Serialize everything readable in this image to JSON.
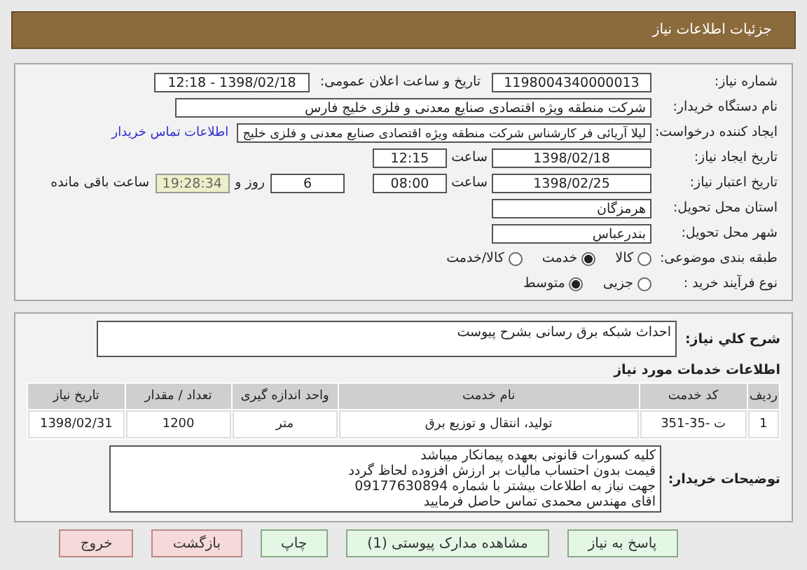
{
  "header": {
    "title": "جزئیات اطلاعات نیاز"
  },
  "need_number": {
    "label": "شماره نیاز:",
    "value": "1198004340000013"
  },
  "announce": {
    "label": "تاریخ و ساعت اعلان عمومی:",
    "value": "1398/02/18 - 12:18"
  },
  "buyer": {
    "label": "نام دستگاه خریدار:",
    "value": "شرکت منطقه ویژه اقتصادی صنایع معدنی و فلزی خلیج فارس"
  },
  "requester": {
    "label": "ایجاد کننده درخواست:",
    "value": "لیلا آریائی فر کارشناس شرکت منطقه ویژه اقتصادی صنایع معدنی و فلزی خلیج",
    "link": "اطلاعات تماس خریدار"
  },
  "created": {
    "label": "تاریخ ایجاد نیاز:",
    "date": "1398/02/18",
    "time_label": "ساعت",
    "time": "12:15"
  },
  "validity": {
    "label": "تاریخ اعتبار نیاز:",
    "date": "1398/02/25",
    "time_label": "ساعت",
    "time": "08:00",
    "days": "6",
    "days_label": "روز و",
    "remaining": "19:28:34",
    "remaining_label": "ساعت باقی مانده"
  },
  "province": {
    "label": "استان محل تحویل:",
    "value": "هرمزگان"
  },
  "city": {
    "label": "شهر محل تحویل:",
    "value": "بندرعباس"
  },
  "category": {
    "label": "طبقه بندی موضوعی:",
    "options": [
      {
        "label": "کالا",
        "selected": false
      },
      {
        "label": "خدمت",
        "selected": true
      },
      {
        "label": "کالا/خدمت",
        "selected": false
      }
    ]
  },
  "process": {
    "label": "نوع فرآیند خرید :",
    "options": [
      {
        "label": "جزیی",
        "selected": false
      },
      {
        "label": "متوسط",
        "selected": true
      }
    ]
  },
  "summary": {
    "label": "شرح کلي نیاز:",
    "value": "احداث شبکه برق رسانی بشرح پیوست"
  },
  "services_title": "اطلاعات خدمات مورد نیاز",
  "table": {
    "columns": [
      "ردیف",
      "کد خدمت",
      "نام خدمت",
      "واحد اندازه گیری",
      "تعداد / مقدار",
      "تاریخ نیاز"
    ],
    "rows": [
      [
        "1",
        "ت -35-351",
        "تولید، انتقال و توزیع برق",
        "متر",
        "1200",
        "1398/02/31"
      ]
    ]
  },
  "notes": {
    "label": "توضیحات خریدار:",
    "lines": [
      "کلیه کسورات قانونی بعهده  پیمانکار میباشد",
      "قیمت بدون احتساب مالیات بر ارزش افزوده لحاظ گردد",
      "جهت نیاز به اطلاعات بیشتر با شماره 09177630894",
      "اقای مهندس محمدی تماس حاصل فرمایید"
    ]
  },
  "buttons": [
    {
      "label": "پاسخ به نیاز",
      "kind": "action"
    },
    {
      "label": "مشاهده مدارک پیوستی (1)",
      "kind": "action"
    },
    {
      "label": "چاپ",
      "kind": "action"
    },
    {
      "label": "بازگشت",
      "kind": "exit"
    },
    {
      "label": "خروج",
      "kind": "exit"
    }
  ]
}
